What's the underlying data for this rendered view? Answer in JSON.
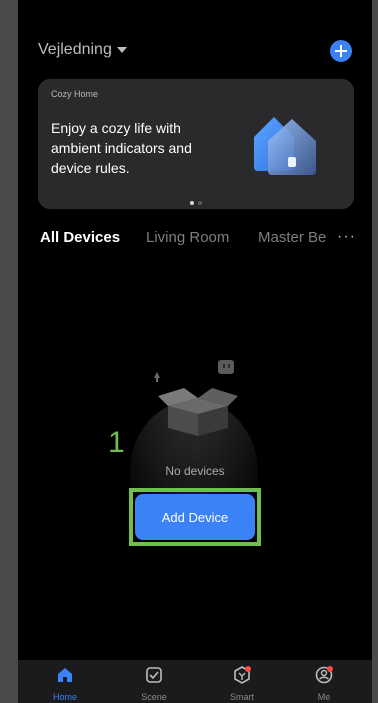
{
  "header": {
    "home_name": "Vejledning"
  },
  "banner": {
    "subtitle": "Cozy Home",
    "text": "Enjoy a cozy life with ambient indicators and device rules."
  },
  "tabs": [
    {
      "label": "All Devices"
    },
    {
      "label": "Living Room"
    },
    {
      "label": "Master Be"
    }
  ],
  "empty_state": {
    "annotation": "1",
    "message": "No devices"
  },
  "add_device": {
    "label": "Add Device"
  },
  "bottom_nav": [
    {
      "label": "Home",
      "icon": "home-icon"
    },
    {
      "label": "Scene",
      "icon": "scene-icon"
    },
    {
      "label": "Smart",
      "icon": "smart-icon"
    },
    {
      "label": "Me",
      "icon": "me-icon"
    }
  ],
  "colors": {
    "accent": "#3b82f6",
    "highlight": "#6fbf4c",
    "background": "#000000"
  }
}
